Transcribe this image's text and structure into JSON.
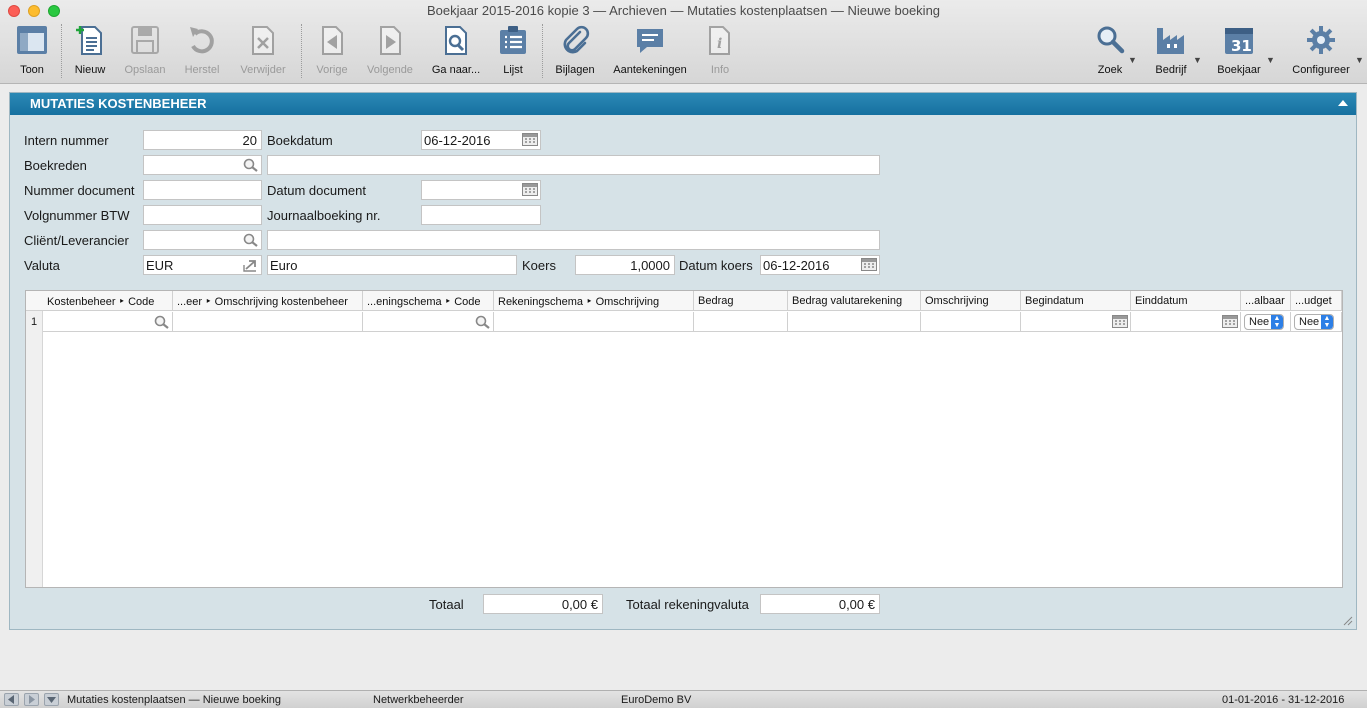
{
  "window": {
    "title": "Boekjaar 2015-2016 kopie 3 — Archieven — Mutaties kostenplaatsen — Nieuwe boeking"
  },
  "toolbar": {
    "toon": "Toon",
    "nieuw": "Nieuw",
    "opslaan": "Opslaan",
    "herstel": "Herstel",
    "verwijder": "Verwijder",
    "vorige": "Vorige",
    "volgende": "Volgende",
    "ganaar": "Ga naar...",
    "lijst": "Lijst",
    "bijlagen": "Bijlagen",
    "aantekeningen": "Aantekeningen",
    "info": "Info",
    "zoek": "Zoek",
    "bedrijf": "Bedrijf",
    "boekjaar": "Boekjaar",
    "boekjaar_day": "31",
    "configureer": "Configureer"
  },
  "panel": {
    "title": "MUTATIES KOSTENBEHEER",
    "labels": {
      "intern_nummer": "Intern nummer",
      "boekdatum": "Boekdatum",
      "boekreden": "Boekreden",
      "nummer_document": "Nummer document",
      "datum_document": "Datum document",
      "volgnummer_btw": "Volgnummer BTW",
      "journaalboeking": "Journaalboeking nr.",
      "client": "Cliënt/Leverancier",
      "valuta": "Valuta",
      "koers": "Koers",
      "datum_koers": "Datum koers"
    },
    "values": {
      "intern_nummer": "20",
      "boekdatum": "06-12-2016",
      "boekreden_code": "",
      "boekreden_desc": "",
      "nummer_document": "",
      "datum_document": "",
      "volgnummer_btw": "",
      "journaalboeking": "",
      "client_code": "",
      "client_desc": "",
      "valuta_code": "EUR",
      "valuta_desc": "Euro",
      "koers": "1,0000",
      "datum_koers": "06-12-2016"
    }
  },
  "grid": {
    "headers": [
      "Kostenbeheer ‣ Code",
      "...eer ‣ Omschrijving kostenbeheer",
      "...eningschema ‣ Code",
      "Rekeningschema ‣ Omschrijving",
      "Bedrag",
      "Bedrag valutarekening",
      "Omschrijving",
      "Begindatum",
      "Einddatum",
      "...albaar",
      "...udget"
    ],
    "rows": [
      {
        "num": "1",
        "albaar": "Nee",
        "udget": "Nee"
      }
    ]
  },
  "totals": {
    "totaal_label": "Totaal",
    "totaal": "0,00 €",
    "rekening_label": "Totaal rekeningvaluta",
    "rekening": "0,00 €"
  },
  "statusbar": {
    "breadcrumb": "Mutaties kostenplaatsen — Nieuwe boeking",
    "user": "Netwerkbeheerder",
    "company": "EuroDemo BV",
    "period": "01-01-2016 - 31-12-2016"
  }
}
